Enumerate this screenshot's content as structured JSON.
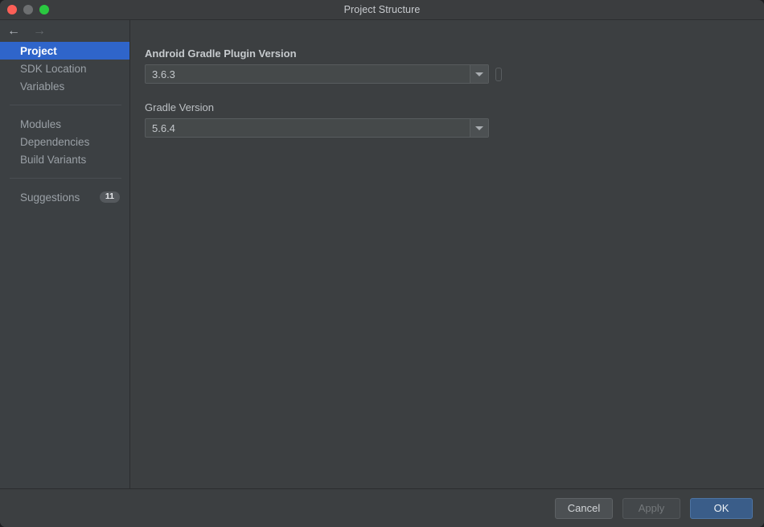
{
  "window": {
    "title": "Project Structure",
    "traffic_lights": [
      {
        "name": "close",
        "color": "#fc5f57"
      },
      {
        "name": "minimize",
        "color": "#6d6f71"
      },
      {
        "name": "maximize",
        "color": "#2ac840"
      }
    ]
  },
  "sidebar": {
    "nav": {
      "back_icon": "←",
      "forward_icon": "→"
    },
    "groups": [
      {
        "items": [
          {
            "label": "Project",
            "selected": true
          },
          {
            "label": "SDK Location",
            "selected": false
          },
          {
            "label": "Variables",
            "selected": false
          }
        ]
      },
      {
        "items": [
          {
            "label": "Modules",
            "selected": false
          },
          {
            "label": "Dependencies",
            "selected": false
          },
          {
            "label": "Build Variants",
            "selected": false
          }
        ]
      },
      {
        "items": [
          {
            "label": "Suggestions",
            "selected": false,
            "badge": "11"
          }
        ]
      }
    ]
  },
  "content": {
    "fields": [
      {
        "label": "Android Gradle Plugin Version",
        "value": "3.6.3",
        "bold_label": true,
        "has_side_marker": true
      },
      {
        "label": "Gradle Version",
        "value": "5.6.4",
        "bold_label": false,
        "has_side_marker": false
      }
    ]
  },
  "footer": {
    "cancel_label": "Cancel",
    "apply_label": "Apply",
    "ok_label": "OK"
  },
  "colors": {
    "accent_selected": "#2f65ca",
    "primary_button": "#3a5d89",
    "window_background": "#3c3f41",
    "sidebar_background": "#3c4043"
  }
}
